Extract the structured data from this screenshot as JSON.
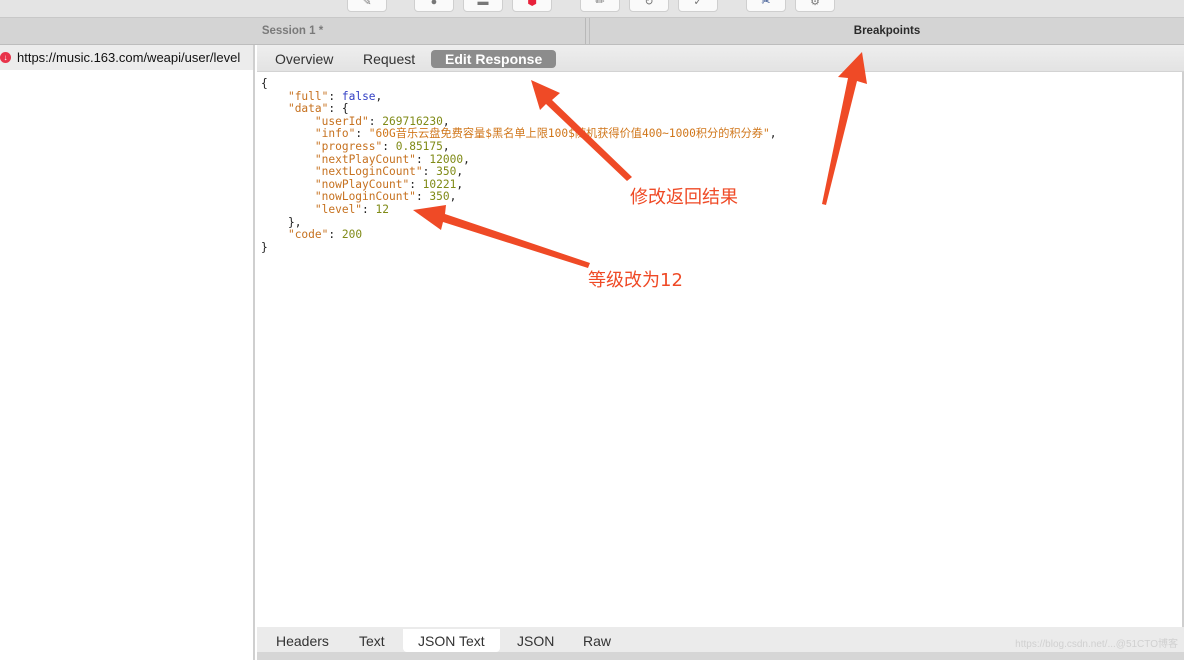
{
  "toolbar": {
    "buttons": [
      {
        "icon": "pen-icon",
        "glyph": "✎"
      },
      {
        "icon": "record-icon",
        "glyph": "●"
      },
      {
        "icon": "throttle-icon",
        "glyph": "▬"
      },
      {
        "icon": "breakpoint-icon",
        "glyph": "⬢"
      },
      {
        "icon": "edit-icon",
        "glyph": "✏"
      },
      {
        "icon": "refresh-icon",
        "glyph": "↻"
      },
      {
        "icon": "execute-icon",
        "glyph": "✓"
      },
      {
        "icon": "tools-icon",
        "glyph": "✂"
      },
      {
        "icon": "settings-icon",
        "glyph": "⚙"
      }
    ]
  },
  "tabs": {
    "session": "Session 1 *",
    "breakpoints": "Breakpoints"
  },
  "left": {
    "request_url": "https://music.163.com/weapi/user/level",
    "request_icon_glyph": "↓"
  },
  "subtabs": [
    "Overview",
    "Request",
    "Edit Response"
  ],
  "active_subtab": "Edit Response",
  "response": {
    "full": "false",
    "data": {
      "userId": "269716230",
      "info": "\"60G音乐云盘免费容量$黑名单上限100$随机获得价值400~1000积分的积分券\"",
      "progress": "0.85175",
      "nextPlayCount": "12000",
      "nextLoginCount": "350",
      "nowPlayCount": "10221",
      "nowLoginCount": "350",
      "level": "12"
    },
    "code": "200"
  },
  "bottom_tabs": [
    "Headers",
    "Text",
    "JSON Text",
    "JSON",
    "Raw"
  ],
  "active_bottom_tab": "JSON Text",
  "watermark": "https://blog.csdn.net/...@51CTO博客",
  "annotations": {
    "edit_response": "修改返回结果",
    "level": "等级改为12",
    "color": "#ef4a26"
  }
}
